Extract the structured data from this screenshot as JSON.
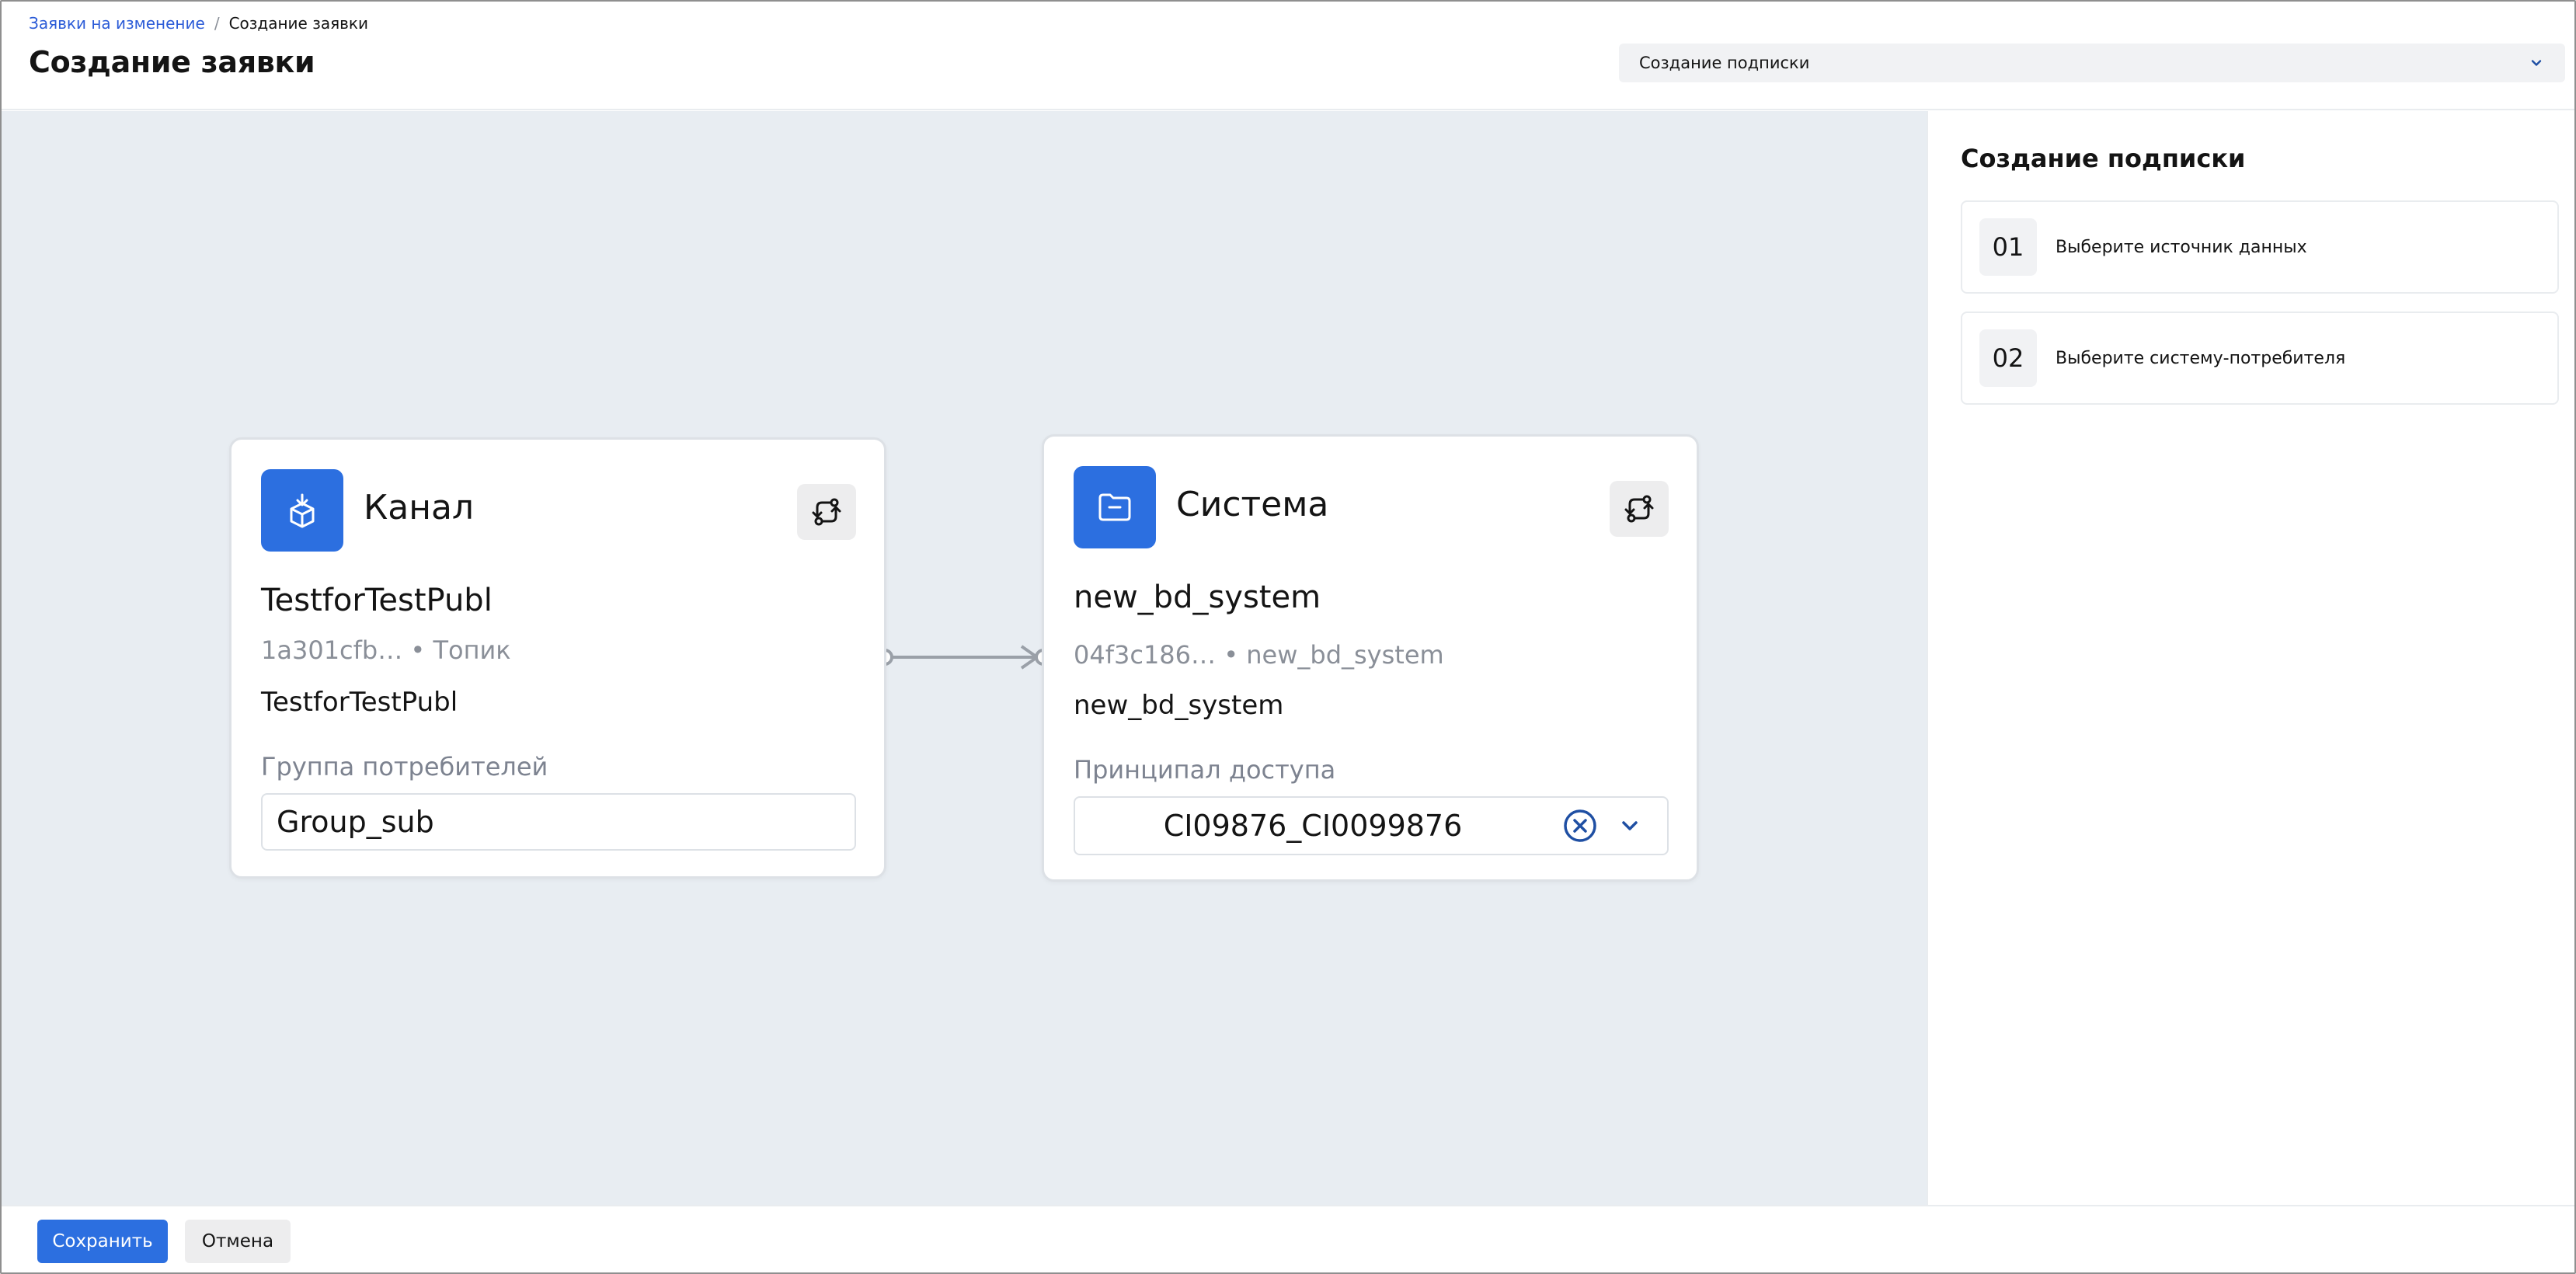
{
  "header": {
    "breadcrumb": {
      "parent": "Заявки на изменение",
      "separator": "/",
      "current": "Создание заявки"
    },
    "title": "Создание заявки",
    "type_select": {
      "value": "Создание подписки",
      "icon": "chevron-down-icon"
    }
  },
  "canvas": {
    "source_node": {
      "type_label": "Канал",
      "icon": "box-download-icon",
      "name": "TestforTestPubl",
      "id_short": "1a301cfb…",
      "meta_separator": "•",
      "kind": "Топик",
      "subtitle": "TestforTestPubl",
      "field_label": "Группа потребителей",
      "field_value": "Group_sub"
    },
    "target_node": {
      "type_label": "Система",
      "icon": "folder-icon",
      "name": "new_bd_system",
      "id_short": "04f3c186…",
      "meta_separator": "•",
      "kind": "new_bd_system",
      "subtitle": "new_bd_system",
      "field_label": "Принципал доступа",
      "field_value": "CI09876_CI0099876"
    },
    "zoom": {
      "in": "+",
      "out": "−"
    }
  },
  "side_panel": {
    "title": "Создание подписки",
    "steps": [
      {
        "number": "01",
        "label": "Выберите источник данных"
      },
      {
        "number": "02",
        "label": "Выберите систему-потребителя"
      }
    ]
  },
  "footer": {
    "save_label": "Сохранить",
    "cancel_label": "Отмена"
  },
  "colors": {
    "accent": "#2c6fe0",
    "canvas_bg": "#e8edf2",
    "link": "#2b5bd7",
    "clear_icon": "#1f4fa3"
  }
}
